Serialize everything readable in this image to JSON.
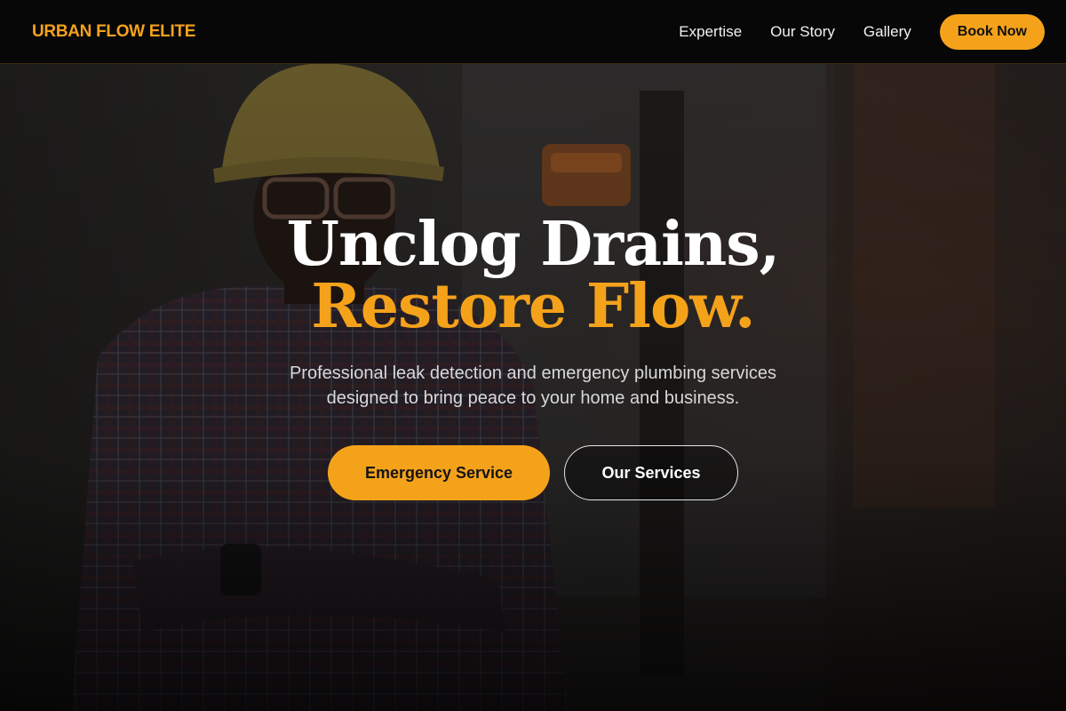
{
  "nav": {
    "brand": "URBAN FLOW ELITE",
    "links": [
      "Expertise",
      "Our Story",
      "Gallery"
    ],
    "book_label": "Book Now"
  },
  "hero": {
    "headline_line1": "Unclog Drains,",
    "headline_line2": "Restore Flow.",
    "subtext": "Professional leak detection and emergency plumbing services designed to bring peace to your home and business.",
    "primary_cta": "Emergency Service",
    "secondary_cta": "Our Services"
  },
  "colors": {
    "accent": "#f5a21b",
    "nav_bg": "#070707",
    "text_light": "#ffffff",
    "subtext": "#d8d8d8"
  }
}
